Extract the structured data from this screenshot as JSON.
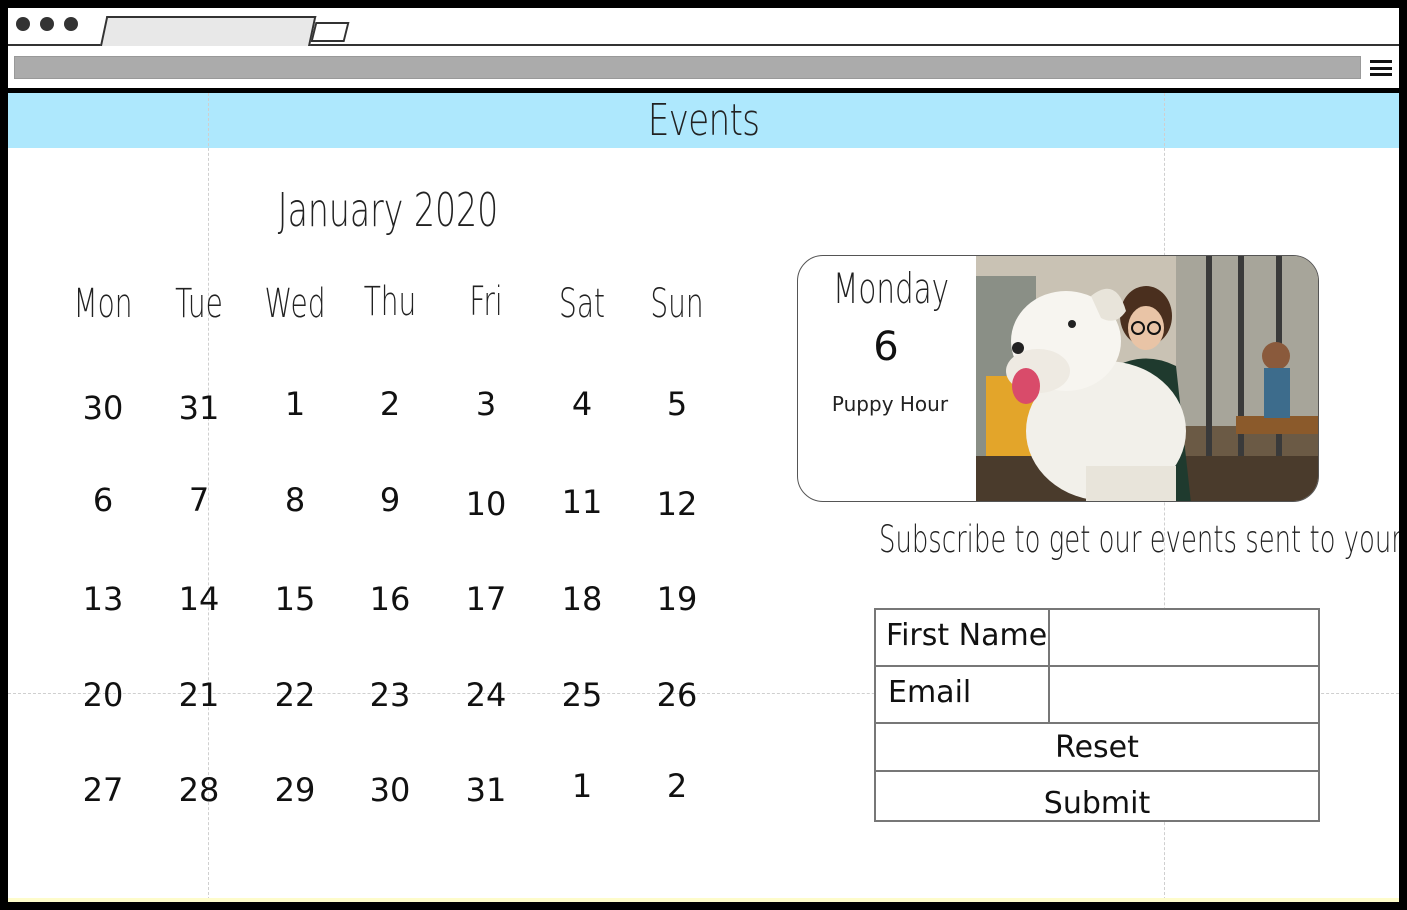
{
  "page": {
    "title": "Events",
    "header_color": "#aee8fd",
    "footer_color": "#fefccb"
  },
  "calendar": {
    "month_title": "January 2020",
    "weekdays": [
      "Mon",
      "Tue",
      "Wed",
      "Thu",
      "Fri",
      "Sat",
      "Sun"
    ],
    "weeks": [
      [
        "30",
        "31",
        "1",
        "2",
        "3",
        "4",
        "5"
      ],
      [
        "6",
        "7",
        "8",
        "9",
        "10",
        "11",
        "12"
      ],
      [
        "13",
        "14",
        "15",
        "16",
        "17",
        "18",
        "19"
      ],
      [
        "20",
        "21",
        "22",
        "23",
        "24",
        "25",
        "26"
      ],
      [
        "27",
        "28",
        "29",
        "30",
        "31",
        "1",
        "2"
      ]
    ]
  },
  "event": {
    "weekday": "Monday",
    "day": "6",
    "name": "Puppy Hour",
    "photo": "photo of a white dog with a smiling woman in a cafe"
  },
  "subscribe": {
    "text": "Subscribe to get our events sent to your email",
    "first_name_label": "First Name",
    "email_label": "Email",
    "first_name_value": "",
    "email_value": "",
    "reset_label": "Reset",
    "submit_label": "Submit"
  },
  "icons": {
    "window_controls": "window-dots-icon",
    "menu": "hamburger-menu-icon"
  }
}
